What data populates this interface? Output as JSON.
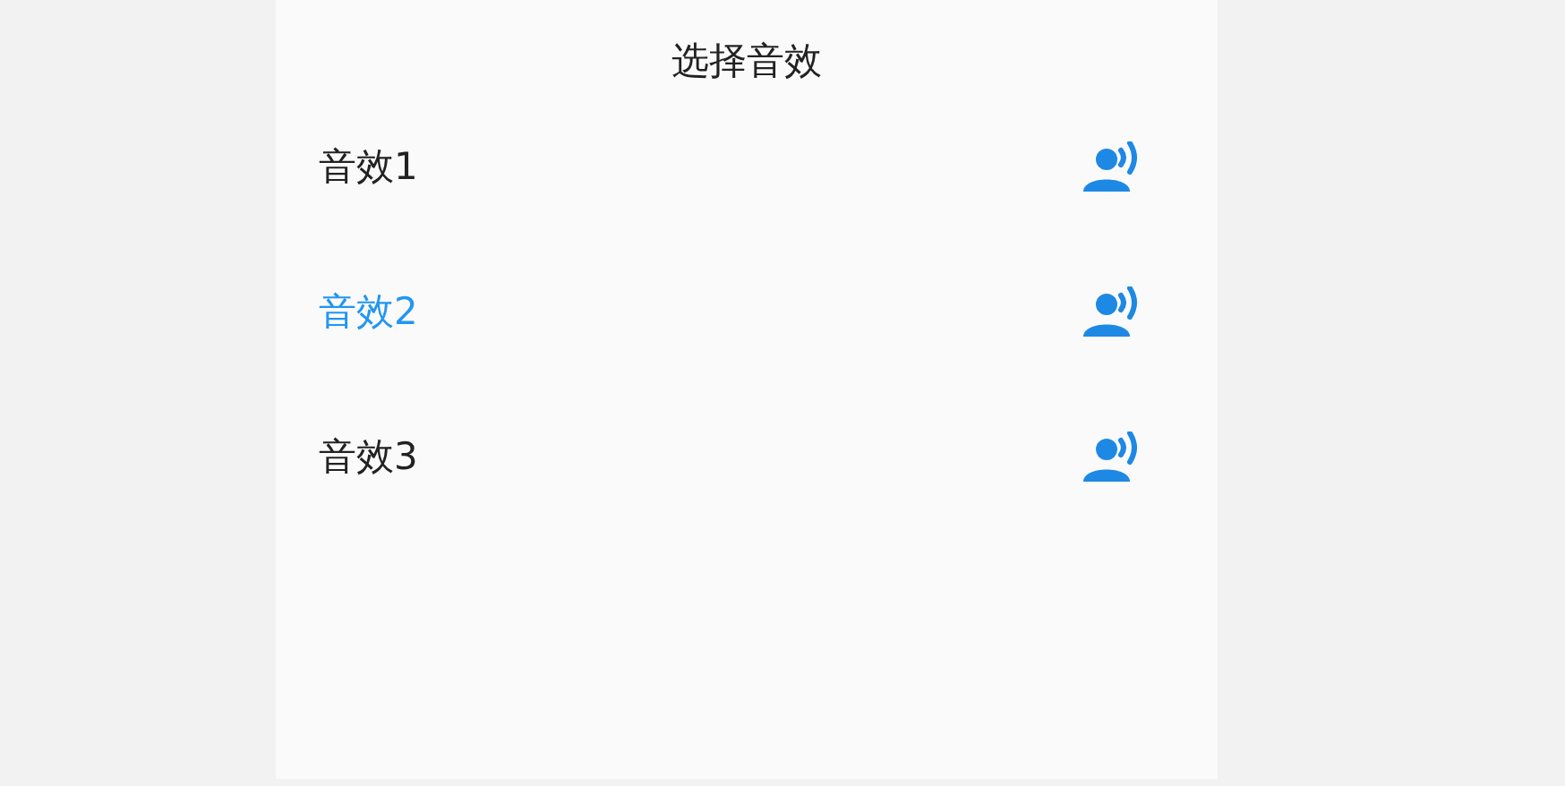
{
  "title": "选择音效",
  "options": [
    {
      "label": "音效1",
      "selected": false
    },
    {
      "label": "音效2",
      "selected": true
    },
    {
      "label": "音效3",
      "selected": false
    }
  ]
}
